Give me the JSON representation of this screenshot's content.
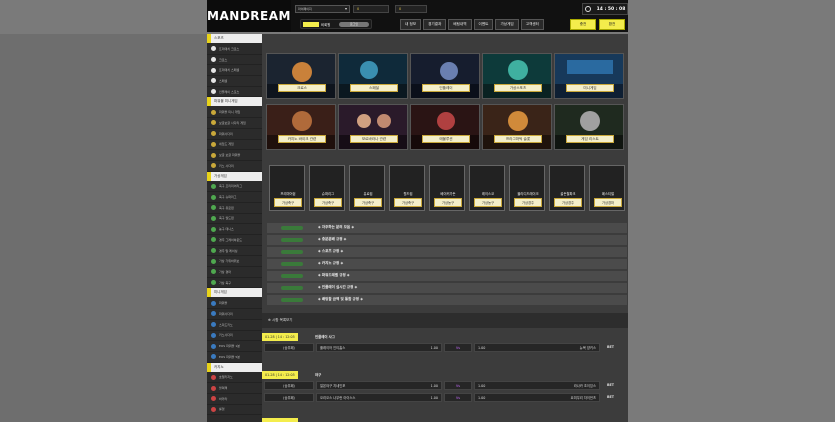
{
  "header": {
    "logo": "MANDREAM",
    "language": "마이페이지",
    "balance1": "0",
    "balance2": "0",
    "user_label": "비회원",
    "user_pill": "로그인",
    "clock": "14 : 50 : 08",
    "menu": [
      "내 정보",
      "경기결과",
      "배팅내역",
      "이벤트",
      "가상게임",
      "고객센터"
    ],
    "yellow_buttons": [
      "충전",
      "환전"
    ]
  },
  "sidebar": {
    "sections": [
      {
        "title": "스포츠",
        "items": [
          "프리매치 크로스",
          "크로스",
          "프리매치 스페셜",
          "스페셜",
          "인플레이 스포츠"
        ]
      },
      {
        "title": "파워볼 미니게임",
        "items": [
          "파워볼 미니 게임",
          "보글보글 사다리 게임",
          "파워사다리",
          "네임드 게임",
          "보글 보글 파워볼",
          "키노 사다리"
        ]
      },
      {
        "title": "가상게임",
        "items": [
          "축구 프리미어리그",
          "축구 슈퍼리그",
          "축구 유로컵",
          "축구 월드컵",
          "농구 테니스",
          "경주 그레이하운드",
          "경주 말 레이싱",
          "가상 가위바위보",
          "가상 경마",
          "가상 축구"
        ]
      },
      {
        "title": "미니게임",
        "items": [
          "파워볼",
          "파워사다리",
          "스피드키노",
          "키노사다리",
          "EOS 파워볼 1분",
          "EOS 파워볼 5분"
        ]
      },
      {
        "title": "카지노",
        "items": [
          "호텔카지노",
          "블랙잭",
          "바카라",
          "룰렛"
        ]
      }
    ]
  },
  "cards_row1": [
    "크로스",
    "스페셜",
    "인플레이",
    "가상스포츠",
    "미니게임"
  ],
  "cards_row2": [
    "카지노 바이크 관련",
    "보르바라나 관련",
    "에볼루션",
    "프라그마틱 슬롯",
    "게임 리스트"
  ],
  "vcards": [
    {
      "title": "프리미어쉽",
      "btn": "가상축구"
    },
    {
      "title": "슈퍼리그",
      "btn": "가상축구"
    },
    {
      "title": "유로컵",
      "btn": "가상축구"
    },
    {
      "title": "월드컵",
      "btn": "가상축구"
    },
    {
      "title": "베이커가든",
      "btn": "가상농구"
    },
    {
      "title": "레이스코",
      "btn": "가상농구"
    },
    {
      "title": "블라디드레이크",
      "btn": "가상경주"
    },
    {
      "title": "골든힐파크",
      "btn": "가상경주"
    },
    {
      "title": "페스티벌",
      "btn": "가상경마"
    }
  ],
  "notices": [
    "◈ 자주하는 분의 모음 ◈",
    "◈ 충분분배 규정 ◈",
    "◈ 스포츠 규정 ◈",
    "◈ 카지노 규정 ◈",
    "◈ 파워드레벨 규정 ◈",
    "◈ 인플레이 실시간 규정 ◈",
    "◈ 배팅할 금액 및 통합 규정 ◈"
  ],
  "matches_header": "⊕ 시합 목록보기",
  "matches": [
    {
      "date": "01-28 | 14 : 12:05",
      "league": "인플레이 사그",
      "rows": [
        {
          "type": "(승무패)",
          "home": "플레이어 인티홈스",
          "odd1": "1.00",
          "mid": "Vs",
          "odd2": "1.00",
          "away": "뉴욕 양키스"
        }
      ]
    },
    {
      "date": "01-28 | 14 : 12:05",
      "league": "야구",
      "rows": [
        {
          "type": "(승무패)",
          "home": "일본야구 지네인포",
          "odd1": "1.00",
          "mid": "Vs",
          "odd2": "1.00",
          "away": "라나카 초이잉스"
        },
        {
          "type": "(승무패)",
          "home": "오리오스 나무런 아이스스",
          "odd1": "1.00",
          "mid": "Vs",
          "odd2": "1.00",
          "away": "요미우리 자이언츠"
        }
      ]
    }
  ],
  "bet_label": "BET"
}
